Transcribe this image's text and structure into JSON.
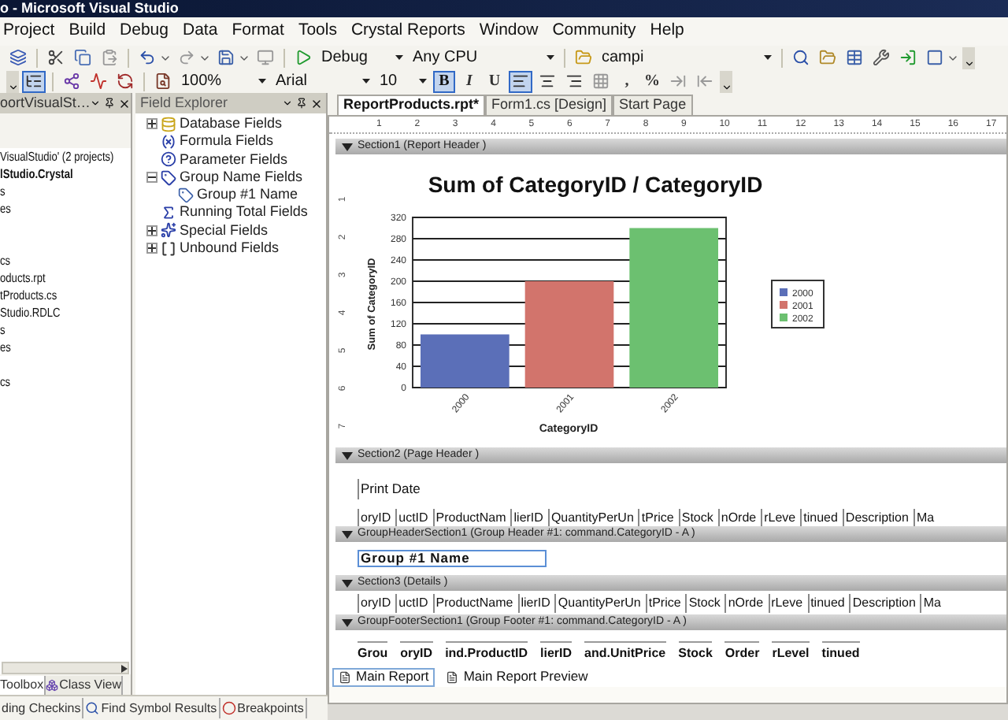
{
  "window": {
    "title": "o - Microsoft Visual Studio"
  },
  "menu": [
    "Project",
    "Build",
    "Debug",
    "Data",
    "Format",
    "Tools",
    "Crystal Reports",
    "Window",
    "Community",
    "Help"
  ],
  "toolbar_1": [
    {
      "kind": "icon"
    },
    {
      "kind": "separator"
    },
    {
      "kind": "icon"
    },
    {
      "kind": "icon"
    },
    {
      "kind": "icon"
    },
    {
      "kind": "separator"
    },
    {
      "kind": "icon-menu"
    },
    {
      "kind": "icon-menu"
    },
    {
      "kind": "icon-menu"
    },
    {
      "kind": "icon"
    },
    {
      "kind": "separator"
    },
    {
      "kind": "icon"
    },
    {
      "kind": "dropdown",
      "value": "Debug"
    },
    {
      "kind": "dropdown",
      "value": "Any CPU"
    },
    {
      "kind": "separator"
    },
    {
      "kind": "icon"
    },
    {
      "kind": "dropdown",
      "value": "campi"
    },
    {
      "kind": "separator"
    },
    {
      "kind": "icon"
    },
    {
      "kind": "icon"
    },
    {
      "kind": "icon"
    },
    {
      "kind": "icon"
    },
    {
      "kind": "icon"
    },
    {
      "kind": "icon-menu"
    },
    {
      "kind": "overflow"
    }
  ],
  "toolbar_2": [
    {
      "kind": "overflow"
    },
    {
      "kind": "icon",
      "selected": true
    },
    {
      "kind": "separator"
    },
    {
      "kind": "icon",
      "selected": false
    },
    {
      "kind": "icon",
      "selected": false
    },
    {
      "kind": "icon",
      "selected": false
    },
    {
      "kind": "separator"
    },
    {
      "kind": "icon",
      "selected": false
    },
    {
      "kind": "dropdown",
      "value": "100%"
    },
    {
      "kind": "dropdown",
      "value": "Arial"
    },
    {
      "kind": "dropdown",
      "value": "10"
    },
    {
      "kind": "text",
      "label": "B",
      "selected": true
    },
    {
      "kind": "text",
      "label": "I",
      "selected": false
    },
    {
      "kind": "text",
      "label": "U",
      "selected": false
    },
    {
      "kind": "icon",
      "selected": true
    },
    {
      "kind": "icon",
      "selected": false
    },
    {
      "kind": "icon",
      "selected": false
    },
    {
      "kind": "icon",
      "selected": false
    },
    {
      "kind": "text",
      "label": ",",
      "selected": false
    },
    {
      "kind": "text",
      "label": "%",
      "selected": false
    },
    {
      "kind": "icon",
      "selected": false
    },
    {
      "kind": "icon",
      "selected": false
    },
    {
      "kind": "overflow"
    }
  ],
  "solution_explorer": {
    "title": "oortVisualSt…",
    "items": [
      {
        "label": "VisualStudio' (2 projects)",
        "bold": false
      },
      {
        "label": "lStudio.Crystal",
        "bold": true
      },
      {
        "label": "s",
        "bold": false
      },
      {
        "label": "es",
        "bold": false
      },
      {
        "label": "cs",
        "bold": false
      },
      {
        "label": "oducts.rpt",
        "bold": false
      },
      {
        "label": "tProducts.cs",
        "bold": false
      },
      {
        "label": "Studio.RDLC",
        "bold": false
      },
      {
        "label": "s",
        "bold": false
      },
      {
        "label": "es",
        "bold": false
      },
      {
        "label": "cs",
        "bold": false
      }
    ],
    "tabs": [
      {
        "label": "Toolbox",
        "selected": true
      },
      {
        "label": "Class View",
        "selected": false
      }
    ]
  },
  "field_explorer": {
    "title": "Field Explorer",
    "items": [
      {
        "label": "Database Fields",
        "kind": "group",
        "expanded": false
      },
      {
        "label": "Formula Fields",
        "kind": "leaf"
      },
      {
        "label": "Parameter Fields",
        "kind": "leaf"
      },
      {
        "label": "Group Name Fields",
        "kind": "group",
        "expanded": true,
        "children": [
          {
            "label": "Group #1 Name",
            "kind": "leaf"
          }
        ]
      },
      {
        "label": "Running Total Fields",
        "kind": "leaf"
      },
      {
        "label": "Special Fields",
        "kind": "group",
        "expanded": false
      },
      {
        "label": "Unbound Fields",
        "kind": "group",
        "expanded": false
      }
    ]
  },
  "bottom_tabs": [
    {
      "label": "ding Checkins",
      "selected": false
    },
    {
      "label": "Find Symbol Results",
      "selected": false
    },
    {
      "label": "Breakpoints",
      "selected": false
    }
  ],
  "document_tabs": [
    {
      "label": "ReportProducts.rpt*",
      "selected": true
    },
    {
      "label": "Form1.cs [Design]",
      "selected": false
    },
    {
      "label": "Start Page",
      "selected": false
    }
  ],
  "ruler": [
    "1",
    "2",
    "3",
    "4",
    "5",
    "6",
    "7",
    "8",
    "9",
    "10",
    "11",
    "12",
    "13",
    "14",
    "15",
    "16",
    "17"
  ],
  "sections": [
    {
      "kind": "chart",
      "title": "Section1 (Report Header )",
      "vertical_ruler": [
        "1",
        "2",
        "3",
        "4",
        "5",
        "6",
        "7"
      ],
      "legend": [
        {
          "label": "2000",
          "color": "#5b6fb8"
        },
        {
          "label": "2001",
          "color": "#d2746c"
        },
        {
          "label": "2002",
          "color": "#6cc070"
        }
      ],
      "chart_data": {
        "type": "bar",
        "title": "Sum of CategoryID / CategoryID",
        "xlabel": "CategoryID",
        "ylabel": "Sum of CategoryID",
        "categories": [
          "2000",
          "2001",
          "2002"
        ],
        "series": [
          {
            "values": [
              100,
              200,
              300
            ]
          }
        ],
        "grid": true,
        "ylim": [
          0,
          320
        ],
        "yticks": [
          0,
          40,
          80,
          120,
          160,
          200,
          240,
          280,
          320
        ]
      }
    },
    {
      "kind": "page-header",
      "title": "Section2 (Page Header )",
      "print_date": "Print Date",
      "fields": [
        "oryID",
        "uctID",
        "ProductNam",
        "lierID",
        "QuantityPerUn",
        "tPrice",
        "Stock",
        "nOrde",
        "rLeve",
        "tinued",
        "Description",
        "Ma"
      ]
    },
    {
      "kind": "group-header",
      "title": "GroupHeaderSection1 (Group Header #1: command.CategoryID - A )",
      "field": "Group #1 Name"
    },
    {
      "kind": "details",
      "title": "Section3 (Details )",
      "fields": [
        "oryID",
        "uctID",
        "ProductName",
        "lierID",
        "QuantityPerUn",
        "tPrice",
        "Stock",
        "nOrde",
        "rLeve",
        "tinued",
        "Description",
        "Ma"
      ]
    },
    {
      "kind": "group-footer",
      "title": "GroupFooterSection1 (Group Footer #1: command.CategoryID - A )",
      "fields": [
        "Grou",
        "oryID",
        "ind.ProductID",
        "lierID",
        "and.UnitPrice",
        "Stock",
        "Order",
        "rLevel",
        "tinued"
      ]
    }
  ],
  "report_tabs": [
    {
      "label": "Main Report",
      "selected": true
    },
    {
      "label": "Main Report Preview",
      "selected": false
    }
  ]
}
